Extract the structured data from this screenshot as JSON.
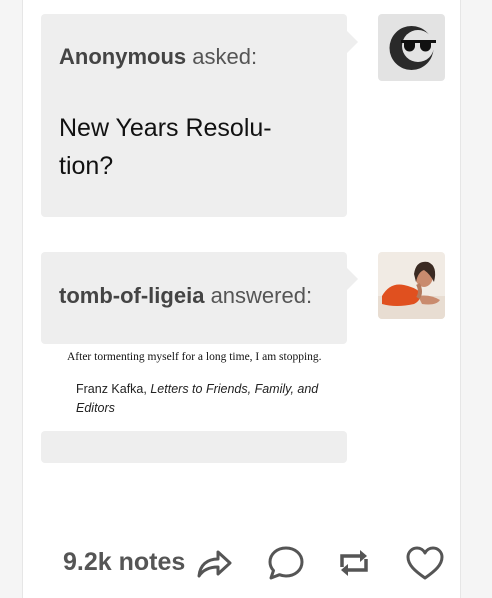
{
  "ask": {
    "asker_name": "Anonymous",
    "asker_verb": "asked:",
    "question_line1": "New Years Resolu-",
    "question_line2": "tion?"
  },
  "answer": {
    "answerer_name": "tomb-of-ligeia",
    "answerer_verb": "answered:",
    "text": "After tormenting myself for a long time, I am stopping.",
    "source_author": "Franz Kafka,",
    "source_title_line1": "Letters to Friends, Family, and",
    "source_title_line2": "Editors"
  },
  "footer": {
    "notes": "9.2k notes",
    "actions": [
      "share-icon",
      "reply-icon",
      "reblog-icon",
      "like-icon"
    ]
  },
  "colors": {
    "bubble": "#eeeeee",
    "icon": "#555555",
    "answer_avatar_accent": "#e0501f"
  }
}
